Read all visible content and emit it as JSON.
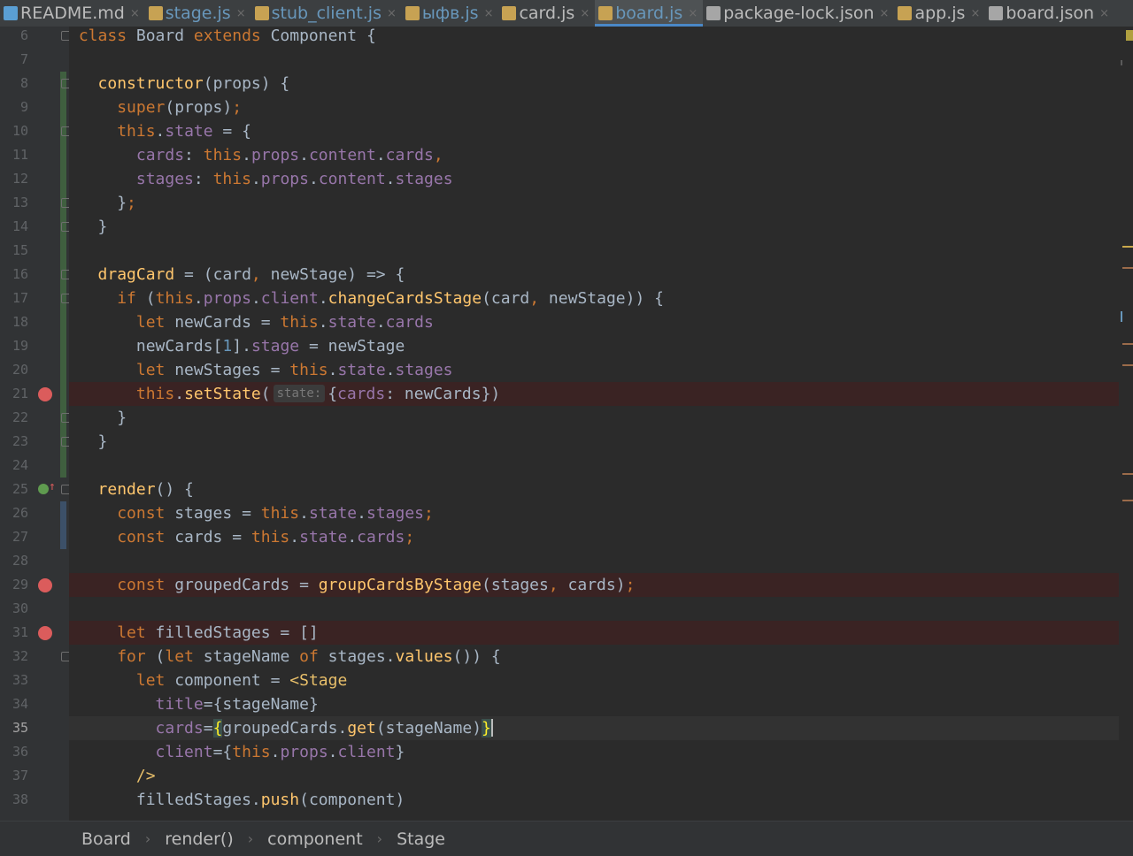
{
  "tabs": [
    {
      "label": "README.md",
      "icon": "markdown-file-icon",
      "kind": "md",
      "modified": false
    },
    {
      "label": "stage.js",
      "icon": "js-file-icon",
      "kind": "js",
      "modified": true
    },
    {
      "label": "stub_client.js",
      "icon": "js-file-icon",
      "kind": "js",
      "modified": true
    },
    {
      "label": "ыфв.js",
      "icon": "js-file-icon",
      "kind": "js",
      "modified": true
    },
    {
      "label": "card.js",
      "icon": "js-file-icon",
      "kind": "js",
      "modified": false
    },
    {
      "label": "board.js",
      "icon": "js-file-icon",
      "kind": "js",
      "modified": true,
      "active": true
    },
    {
      "label": "package-lock.json",
      "icon": "json-file-icon",
      "kind": "json",
      "modified": false
    },
    {
      "label": "app.js",
      "icon": "js-file-icon",
      "kind": "js",
      "modified": false
    },
    {
      "label": "board.json",
      "icon": "json-file-icon",
      "kind": "json",
      "modified": false
    }
  ],
  "lines": [
    {
      "n": "6"
    },
    {
      "n": "7"
    },
    {
      "n": "8"
    },
    {
      "n": "9"
    },
    {
      "n": "10"
    },
    {
      "n": "11"
    },
    {
      "n": "12"
    },
    {
      "n": "13"
    },
    {
      "n": "14"
    },
    {
      "n": "15"
    },
    {
      "n": "16"
    },
    {
      "n": "17"
    },
    {
      "n": "18"
    },
    {
      "n": "19"
    },
    {
      "n": "20"
    },
    {
      "n": "21"
    },
    {
      "n": "22"
    },
    {
      "n": "23"
    },
    {
      "n": "24"
    },
    {
      "n": "25"
    },
    {
      "n": "26"
    },
    {
      "n": "27"
    },
    {
      "n": "28"
    },
    {
      "n": "29"
    },
    {
      "n": "30"
    },
    {
      "n": "31"
    },
    {
      "n": "32"
    },
    {
      "n": "33"
    },
    {
      "n": "34"
    },
    {
      "n": "35"
    },
    {
      "n": "36"
    },
    {
      "n": "37"
    },
    {
      "n": "38"
    }
  ],
  "code": {
    "l6": [
      "class",
      " Board ",
      "extends",
      " Component {"
    ],
    "l8": [
      "constructor",
      "(props) {"
    ],
    "l9": [
      "super",
      "(props)",
      ";"
    ],
    "l10": [
      "this",
      ".",
      "state",
      " = {"
    ],
    "l11": [
      "cards",
      ": ",
      "this",
      ".",
      "props",
      ".",
      "content",
      ".",
      "cards",
      ","
    ],
    "l12": [
      "stages",
      ": ",
      "this",
      ".",
      "props",
      ".",
      "content",
      ".",
      "stages"
    ],
    "l13": [
      "}",
      ";"
    ],
    "l14": [
      "}"
    ],
    "l16": [
      "dragCard",
      " = (card",
      ",",
      " newStage) => {"
    ],
    "l17": [
      "if",
      " (",
      "this",
      ".",
      "props",
      ".",
      "client",
      ".",
      "changeCardsStage",
      "(card",
      ",",
      " newStage)) {"
    ],
    "l18": [
      "let",
      " newCards = ",
      "this",
      ".",
      "state",
      ".",
      "cards"
    ],
    "l19": [
      "newCards[",
      "1",
      "].",
      "stage",
      " = newStage"
    ],
    "l20": [
      "let",
      " newStages = ",
      "this",
      ".",
      "state",
      ".",
      "stages"
    ],
    "l21": [
      "this",
      ".",
      "setState",
      "(",
      "state:",
      "{",
      "cards",
      ": newCards})"
    ],
    "l22": [
      "}"
    ],
    "l23": [
      "}"
    ],
    "l25": [
      "render",
      "() {"
    ],
    "l26": [
      "const",
      " stages = ",
      "this",
      ".",
      "state",
      ".",
      "stages",
      ";"
    ],
    "l27": [
      "const",
      " cards = ",
      "this",
      ".",
      "state",
      ".",
      "cards",
      ";"
    ],
    "l29": [
      "const",
      " groupedCards = ",
      "groupCardsByStage",
      "(stages",
      ",",
      " cards)",
      ";"
    ],
    "l31": [
      "let",
      " filledStages = []"
    ],
    "l32": [
      "for",
      " (",
      "let",
      " stageName ",
      "of",
      " stages.",
      "values",
      "()) {"
    ],
    "l33": [
      "let",
      " component = ",
      "<Stage"
    ],
    "l34": [
      "title",
      "=",
      "{stageName}"
    ],
    "l35": [
      "cards",
      "=",
      "{",
      "groupedCards.",
      "get",
      "(stageName)",
      "}"
    ],
    "l36": [
      "client",
      "=",
      "{",
      "this",
      ".",
      "props",
      ".",
      "client",
      "}"
    ],
    "l37": [
      "/>"
    ],
    "l38": [
      "filledStages.",
      "push",
      "(component)"
    ]
  },
  "breadcrumb": [
    "Board",
    "render()",
    "component",
    "Stage"
  ],
  "colors": {
    "keyword": "#cc7832",
    "function": "#ffc66d",
    "property": "#9876aa",
    "number": "#6897bb",
    "breakpoint": "#db5c5c"
  }
}
